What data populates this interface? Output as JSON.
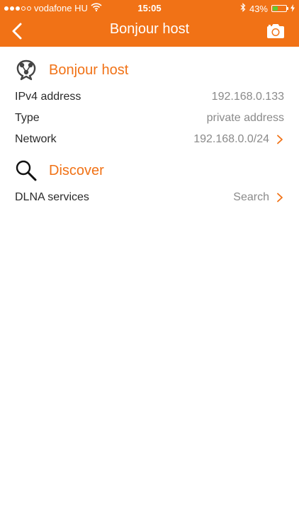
{
  "status_bar": {
    "carrier": "vodafone HU",
    "time": "15:05",
    "battery_percent": "43%",
    "battery_level": 0.43,
    "signal_bars_filled": 3,
    "signal_bars_total": 5
  },
  "nav": {
    "title": "Bonjour host"
  },
  "sections": {
    "bonjour": {
      "title": "Bonjour host",
      "rows": [
        {
          "label": "IPv4 address",
          "value": "192.168.0.133"
        },
        {
          "label": "Type",
          "value": "private address"
        },
        {
          "label": "Network",
          "value": "192.168.0.0/24"
        }
      ]
    },
    "discover": {
      "title": "Discover",
      "rows": [
        {
          "label": "DLNA services",
          "value": "Search"
        }
      ]
    }
  },
  "colors": {
    "accent": "#f17216",
    "battery_fill": "#5ecb33",
    "label_text": "#2a2a2a",
    "value_text": "#8a8a8a"
  },
  "icons": {
    "back": "chevron-left-icon",
    "camera": "camera-icon",
    "bonjour": "bonjour-icon",
    "discover": "magnifier-icon",
    "row_chevron": "chevron-right-icon",
    "wifi": "wifi-icon",
    "bluetooth": "bluetooth-icon",
    "charging": "charging-bolt-icon"
  }
}
